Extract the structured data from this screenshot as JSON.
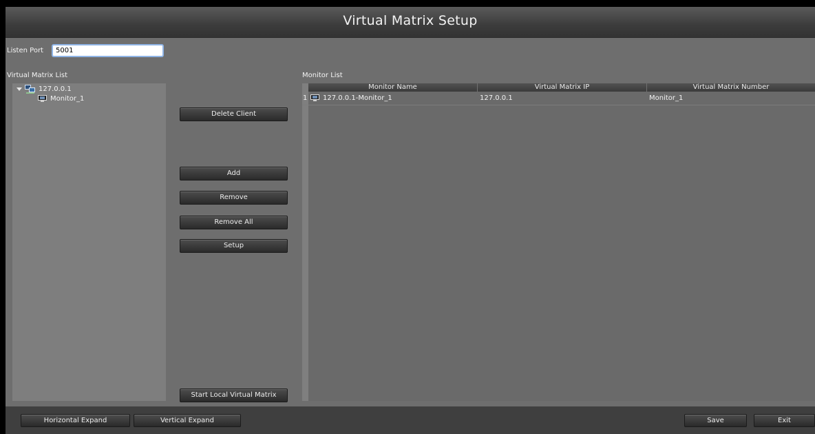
{
  "window": {
    "title": "Virtual Matrix Setup"
  },
  "listen_port": {
    "label": "Listen Port",
    "value": "5001"
  },
  "virtual_matrix_list": {
    "label": "Virtual Matrix List",
    "nodes": [
      {
        "label": "127.0.0.1",
        "icon": "network-icon",
        "expanded": true,
        "children": [
          {
            "label": "Monitor_1",
            "icon": "monitor-icon"
          }
        ]
      }
    ]
  },
  "actions": {
    "delete_client": "Delete Client",
    "add": "Add",
    "remove": "Remove",
    "remove_all": "Remove All",
    "setup": "Setup",
    "start_local": "Start Local Virtual Matrix"
  },
  "monitor_list": {
    "label": "Monitor List",
    "columns": [
      "Monitor Name",
      "Virtual Matrix IP",
      "Virtual Matrix Number"
    ],
    "rows": [
      {
        "index": "1",
        "name": "127.0.0.1-Monitor_1",
        "ip": "127.0.0.1",
        "number": "Monitor_1"
      }
    ]
  },
  "footer": {
    "horizontal_expand": "Horizontal Expand",
    "vertical_expand": "Vertical Expand",
    "save": "Save",
    "exit": "Exit"
  },
  "colors": {
    "window_bg": "#6e6e6e",
    "tree_bg": "#7e7e7e",
    "input_focus": "#8fb4e6",
    "button_bg": "#2a2a2a"
  }
}
